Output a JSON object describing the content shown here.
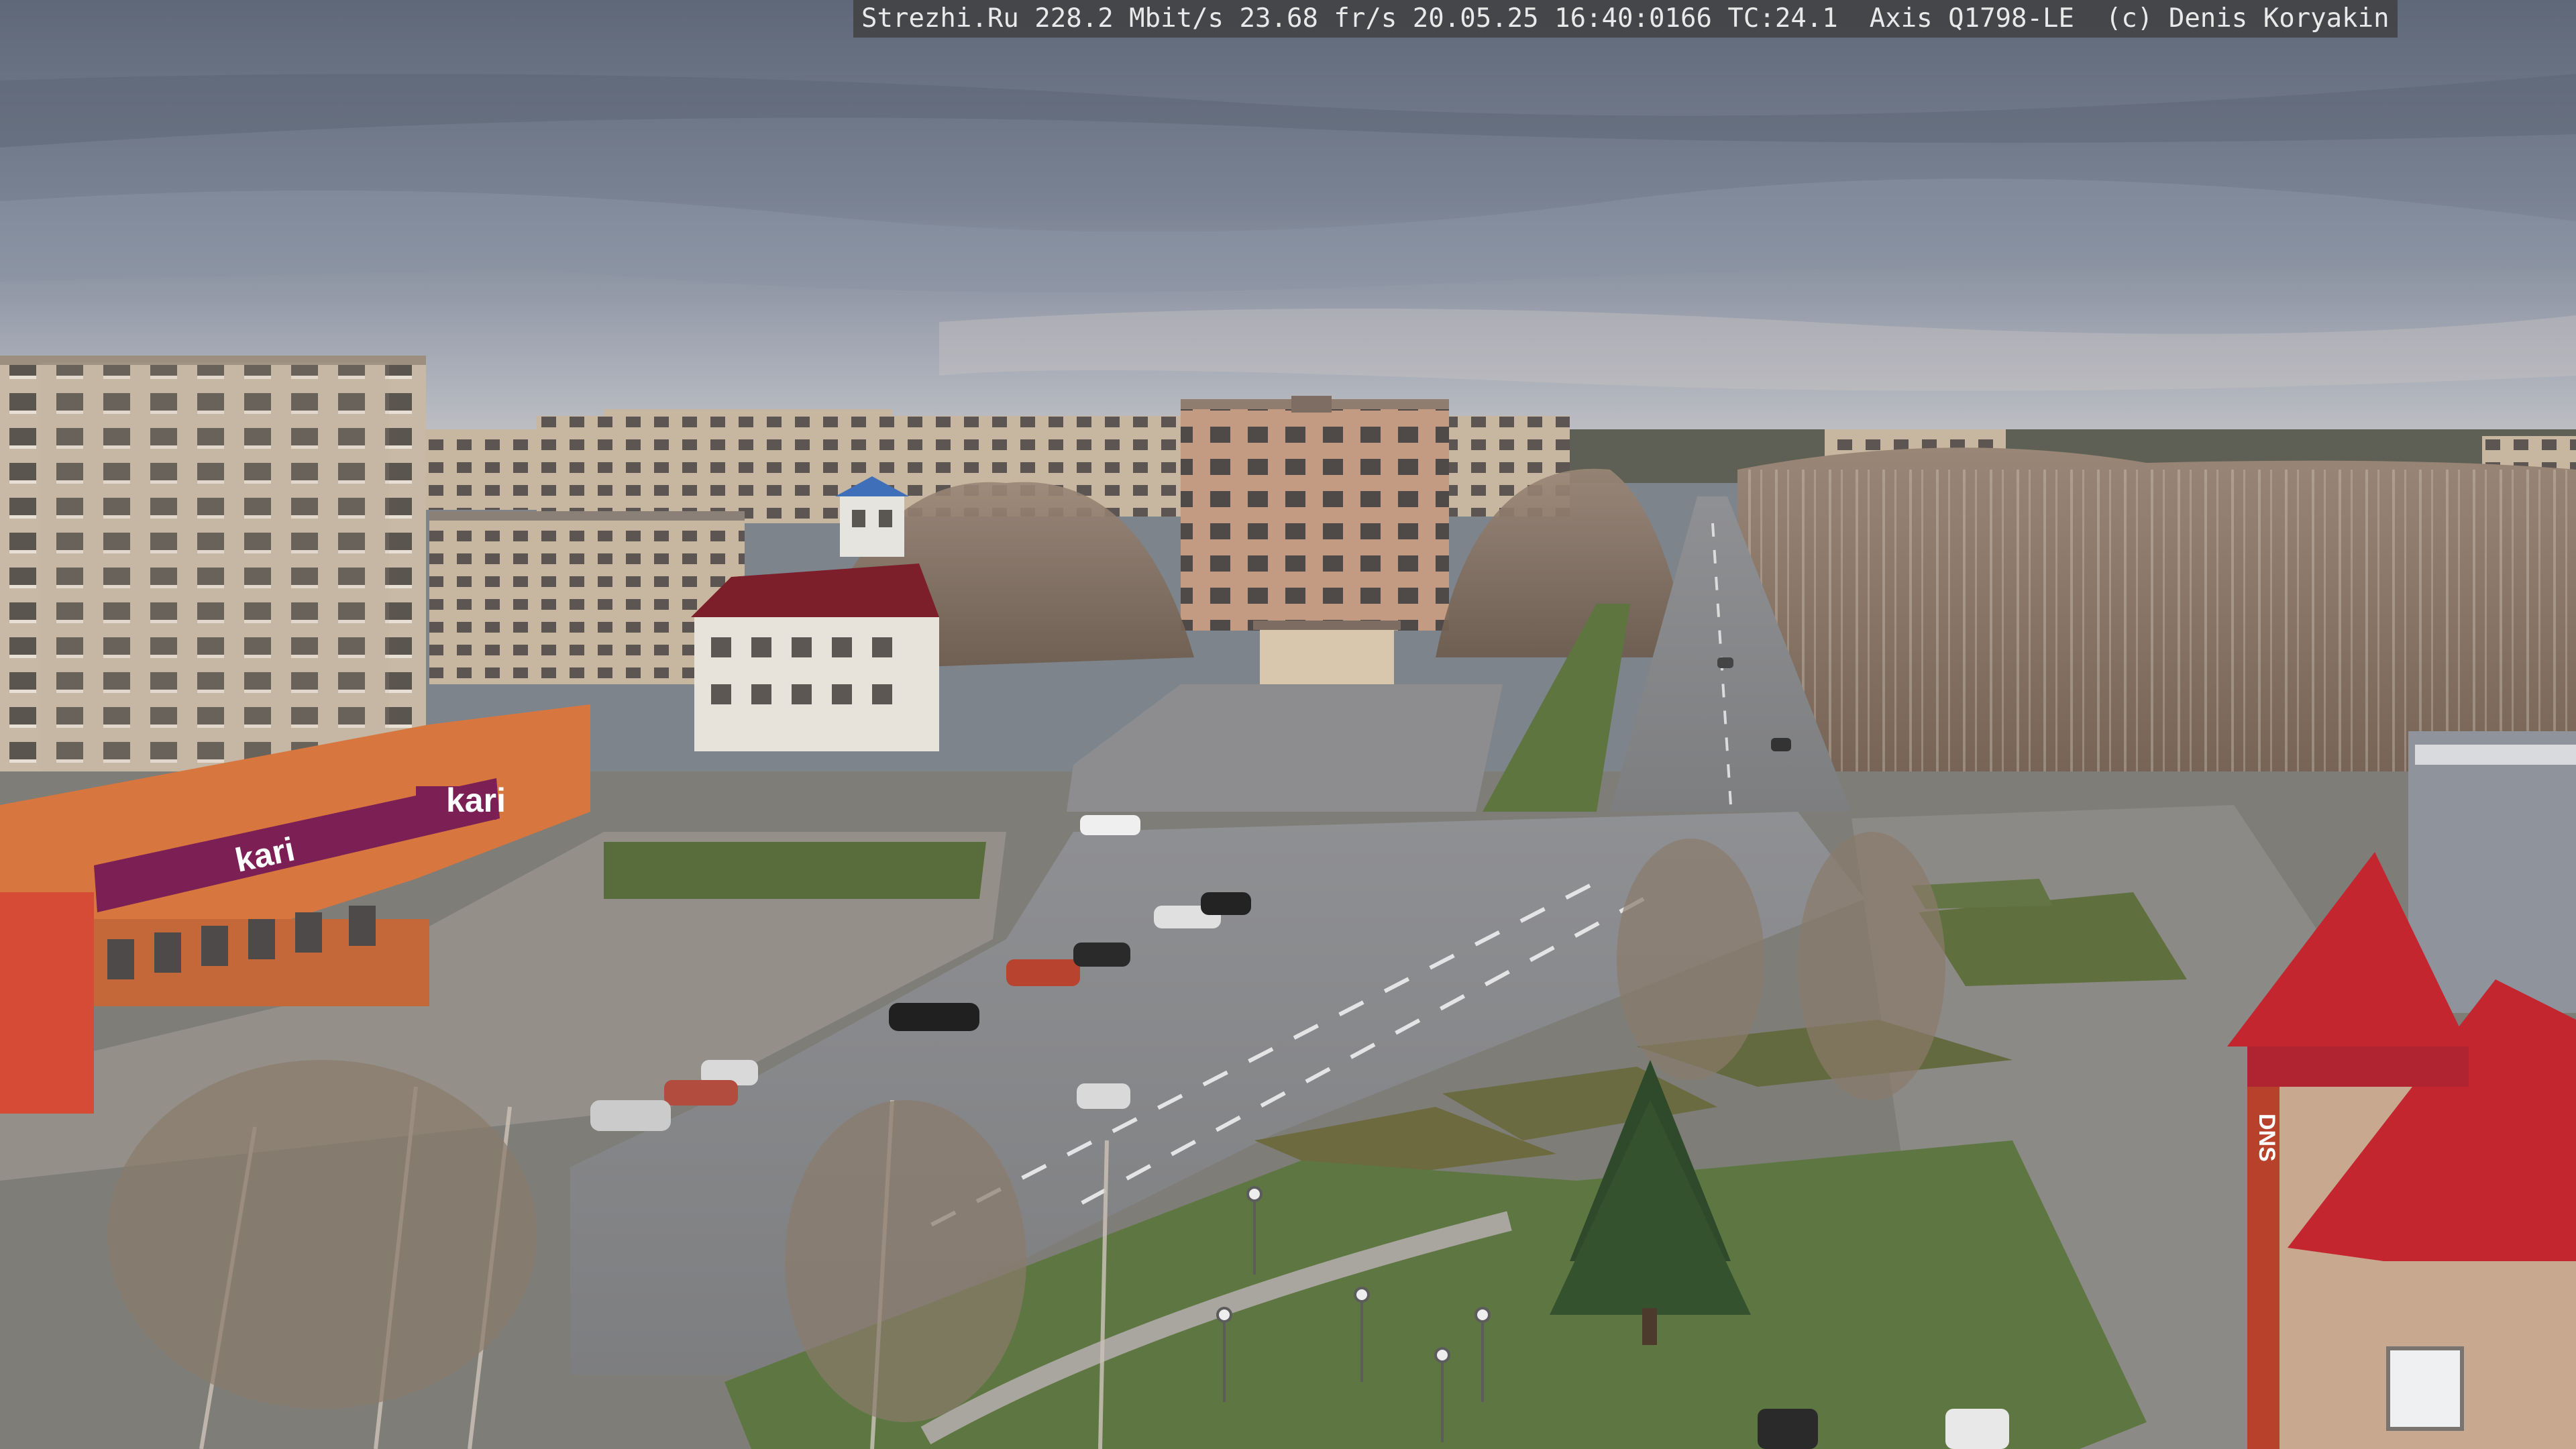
{
  "overlay": {
    "text": "Strezhi.Ru 228.2 Mbit/s 23.68 fr/s 20.05.25 16:40:0166 TC:24.1  Axis Q1798-LE  (c) Denis Koryakin"
  },
  "signs": {
    "kari_roof": "kari",
    "kari_banner": "kari",
    "dns": "DNS"
  },
  "colors": {
    "sky_top": "#6c7585",
    "sky_horizon": "#b9bcc3",
    "road": "#8d8e90",
    "grass": "#5d7440",
    "kari_banner": "#7b1f55",
    "red_roof": "#c3262f",
    "brick": "#c9a890"
  }
}
